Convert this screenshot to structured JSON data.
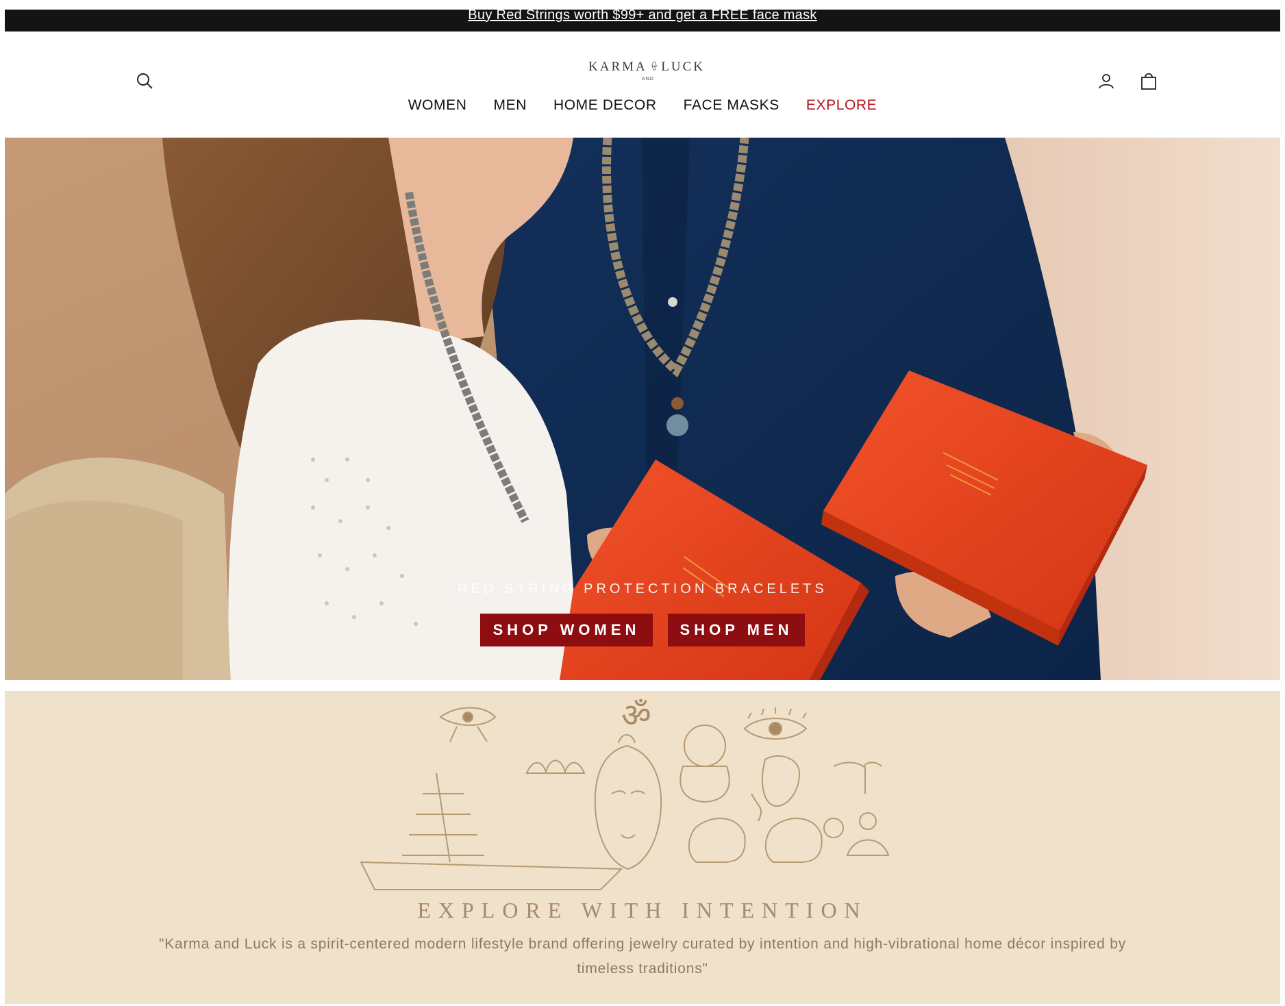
{
  "announcement": {
    "text": "Buy Red Strings worth $99+ and get a FREE face mask"
  },
  "header": {
    "logo_left": "KARMA",
    "logo_small": "AND",
    "logo_right": "LUCK",
    "icons": {
      "search": "search-icon",
      "account": "user-icon",
      "cart": "shopping-bag-icon"
    },
    "nav": [
      {
        "label": "WOMEN"
      },
      {
        "label": "MEN"
      },
      {
        "label": "HOME DECOR"
      },
      {
        "label": "FACE MASKS"
      },
      {
        "label": "EXPLORE"
      }
    ],
    "nav_accent_color": "#b3111d"
  },
  "hero": {
    "subtitle": "RED STRING PROTECTION BRACELETS",
    "shop_women": "SHOP WOMEN",
    "shop_men": "SHOP MEN",
    "button_color": "#8e0d11"
  },
  "explore": {
    "title": "EXPLORE WITH INTENTION",
    "quote": "\"Karma and Luck is a spirit-centered modern lifestyle brand offering jewelry curated by intention and high-vibrational home décor inspired by timeless traditions\"",
    "background_color": "#efe1ca"
  }
}
